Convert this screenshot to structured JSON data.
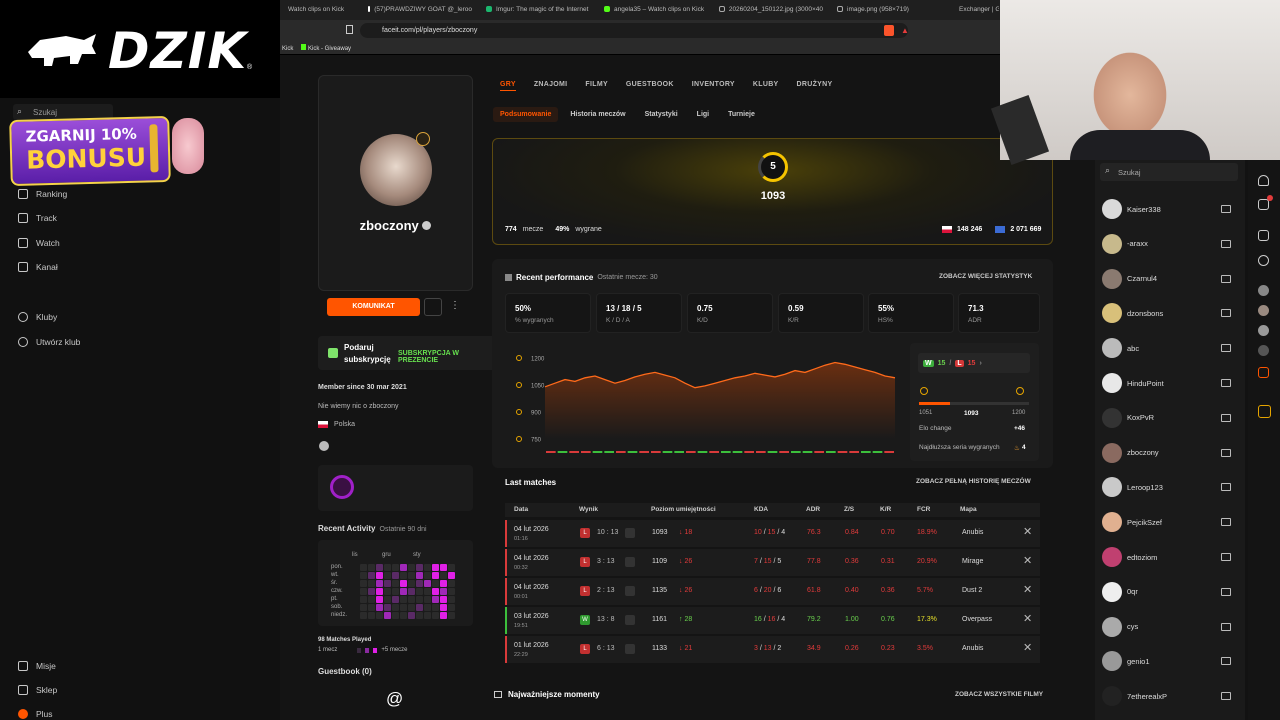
{
  "overlay": {
    "brand": "DZIK",
    "reg": "®",
    "bonus_line1": "ZGARNIJ 10%",
    "bonus_line2": "BONUSU"
  },
  "kick_nav": {
    "search_placeholder": "Szukaj",
    "items": [
      "Ranking",
      "Track",
      "Watch",
      "Kanał"
    ],
    "clubs": [
      "Kluby",
      "Utwórz klub"
    ],
    "bottom": [
      "Misje",
      "Sklep",
      "Plus"
    ]
  },
  "browser": {
    "tabs": [
      "Watch clips on Kick",
      "(57)PRAWDZIWY GOAT @_leroo",
      "Imgur: The magic of the Internet",
      "angela35 – Watch clips on Kick",
      "20260204_150122.jpg (3000×40",
      "image.png (958×719)",
      "Exchanger | G45"
    ],
    "url": "faceit.com/pl/players/zboczony",
    "bookmarks": [
      "Kick",
      "Kick - Giveaway"
    ]
  },
  "profile": {
    "name": "zboczony",
    "komunikat": "KOMUNIKAT",
    "sub_line1": "Podaruj subskrypcję",
    "sub_line2": "SUBSKRYPCJA W PREZENCIE",
    "member_since": "Member since 30 mar 2021",
    "bio": "Nie wiemy nic o zboczony",
    "country": "Polska",
    "recent_activity": "Recent Activity",
    "recent_activity_sub": "Ostatnie 90 dni",
    "months": [
      "lis",
      "gru",
      "sty"
    ],
    "days": [
      "pon.",
      "wt.",
      "śr.",
      "czw.",
      "pt.",
      "sob.",
      "niedz."
    ],
    "matches_played": "98 Matches Played",
    "legend_left": "1 mecz",
    "legend_right": "+5 mecze",
    "guestbook": "Guestbook (0)"
  },
  "main_tabs": [
    "GRY",
    "ZNAJOMI",
    "FILMY",
    "GUESTBOOK",
    "INVENTORY",
    "KLUBY",
    "DRUŻYNY"
  ],
  "sub_tabs": [
    "Podsumowanie",
    "Historia meczów",
    "Statystyki",
    "Ligi",
    "Turnieje"
  ],
  "elo": {
    "level": "5",
    "value": "1093",
    "matches": "774",
    "matches_label": "mecze",
    "winrate": "49%",
    "winrate_label": "wygrane",
    "country_rank": "148 246",
    "world_rank": "2 071 669"
  },
  "performance": {
    "title": "Recent performance",
    "subtitle": "Ostatnie mecze: 30",
    "more": "ZOBACZ WIĘCEJ STATYSTYK",
    "kpis": [
      {
        "v": "50%",
        "l": "% wygranych"
      },
      {
        "v": "13 / 18 / 5",
        "l": "K / D / A"
      },
      {
        "v": "0.75",
        "l": "K/D"
      },
      {
        "v": "0.59",
        "l": "K/R"
      },
      {
        "v": "55%",
        "l": "HS%"
      },
      {
        "v": "71.3",
        "l": "ADR"
      }
    ],
    "wins": "15",
    "losses": "15",
    "elo_min": "1051",
    "elo_now": "1093",
    "elo_max": "1200",
    "elo_change_label": "Elo change",
    "elo_change": "+46",
    "streak_label": "Najdłuższa seria wygranych",
    "streak": "4"
  },
  "chart_data": {
    "type": "area",
    "y_ticks": [
      "1200",
      "1050",
      "900",
      "750"
    ],
    "ylim": [
      750,
      1250
    ],
    "values": [
      1040,
      1060,
      1080,
      1070,
      1090,
      1100,
      1080,
      1060,
      1075,
      1095,
      1110,
      1120,
      1105,
      1090,
      1060,
      1035,
      1045,
      1060,
      1075,
      1090,
      1100,
      1115,
      1105,
      1095,
      1110,
      1130,
      1120,
      1140,
      1160,
      1175,
      1165,
      1150,
      1135,
      1120,
      1100,
      1090
    ],
    "results": [
      "L",
      "W",
      "L",
      "L",
      "W",
      "W",
      "L",
      "W",
      "L",
      "L",
      "W",
      "W",
      "L",
      "W",
      "L",
      "W",
      "W",
      "L",
      "L",
      "W",
      "L",
      "W",
      "W",
      "L",
      "W",
      "L",
      "L",
      "W",
      "W",
      "L"
    ]
  },
  "matches": {
    "title": "Last matches",
    "more": "ZOBACZ PEŁNĄ HISTORIĘ MECZÓW",
    "headers": [
      "Data",
      "Wynik",
      "Poziom umiejętności",
      "KDA",
      "ADR",
      "Z/S",
      "K/R",
      "FCR",
      "Mapa"
    ],
    "rows": [
      {
        "date": "04 lut 2026",
        "time": "01:16",
        "res": "L",
        "score": "10 : 13",
        "elo": "1093",
        "delta": "↓ 18",
        "kda": "10 / 15 / 4",
        "adr": "76.3",
        "zs": "0.84",
        "kr": "0.70",
        "fcr": "18.9%",
        "map": "Anubis"
      },
      {
        "date": "04 lut 2026",
        "time": "00:32",
        "res": "L",
        "score": "3 : 13",
        "elo": "1109",
        "delta": "↓ 26",
        "kda": "7 / 15 / 5",
        "adr": "77.8",
        "zs": "0.36",
        "kr": "0.31",
        "fcr": "20.9%",
        "map": "Mirage"
      },
      {
        "date": "04 lut 2026",
        "time": "00:01",
        "res": "L",
        "score": "2 : 13",
        "elo": "1135",
        "delta": "↓ 26",
        "kda": "6 / 20 / 6",
        "adr": "61.8",
        "zs": "0.40",
        "kr": "0.36",
        "fcr": "5.7%",
        "map": "Dust 2"
      },
      {
        "date": "03 lut 2026",
        "time": "19:51",
        "res": "W",
        "score": "13 : 8",
        "elo": "1161",
        "delta": "↑ 28",
        "kda": "16 / 16 / 4",
        "adr": "79.2",
        "zs": "1.00",
        "kr": "0.76",
        "fcr": "17.3%",
        "map": "Overpass"
      },
      {
        "date": "01 lut 2026",
        "time": "22:29",
        "res": "L",
        "score": "6 : 13",
        "elo": "1133",
        "delta": "↓ 21",
        "kda": "3 / 13 / 2",
        "adr": "34.9",
        "zs": "0.26",
        "kr": "0.23",
        "fcr": "3.5%",
        "map": "Anubis"
      }
    ]
  },
  "highlights": {
    "title": "Najważniejsze momenty",
    "more": "ZOBACZ WSZYSTKIE FILMY"
  },
  "friends": {
    "search_placeholder": "Szukaj",
    "list": [
      "Kaiser338",
      "-araxx",
      "Czarnul4",
      "dzonsbons",
      "abc",
      "HinduPoint",
      "KoxPvR",
      "zboczony",
      "Leroop123",
      "PejcikSzef",
      "edtoziom",
      "0qr",
      "cys",
      "genio1",
      "7etherealxP"
    ]
  }
}
